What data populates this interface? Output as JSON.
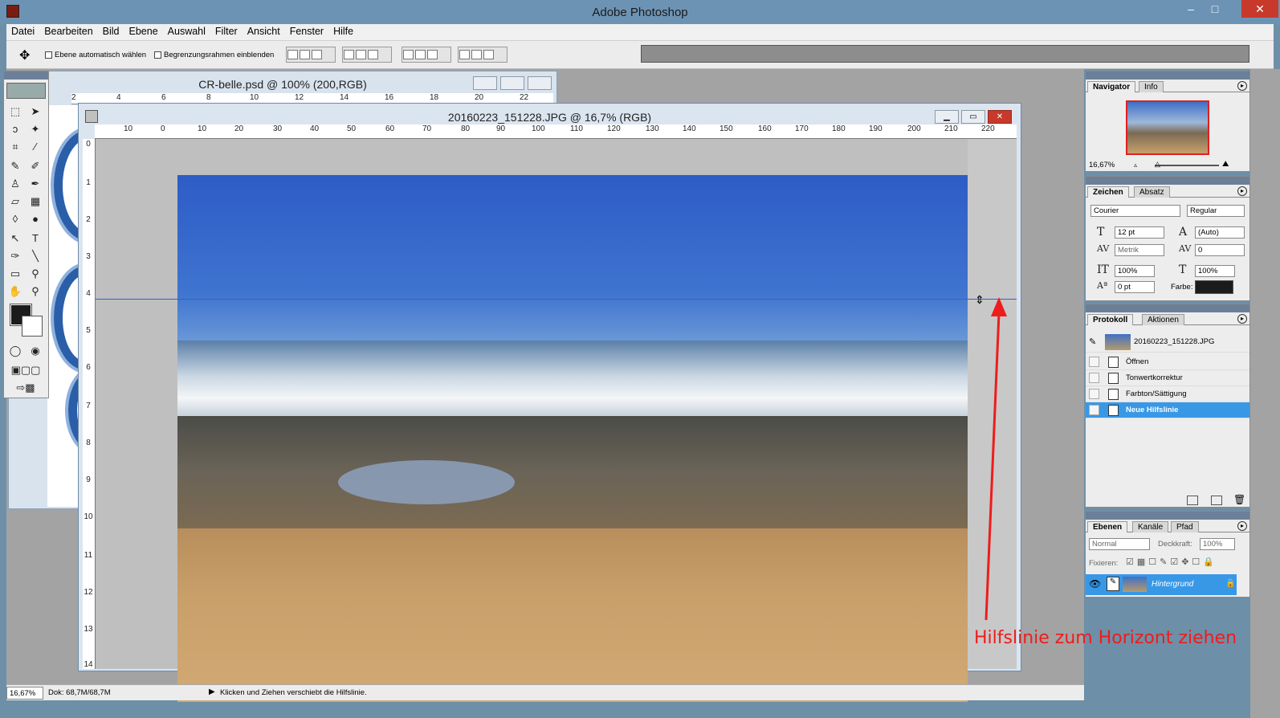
{
  "app": {
    "title": "Adobe Photoshop",
    "window_controls": {
      "minimize": "–",
      "maximize": "□",
      "close": "✕"
    }
  },
  "menu": {
    "items": [
      "Datei",
      "Bearbeiten",
      "Bild",
      "Ebene",
      "Auswahl",
      "Filter",
      "Ansicht",
      "Fenster",
      "Hilfe"
    ]
  },
  "options": {
    "auto_select": "Ebene automatisch wählen",
    "bounding_box": "Begrenzungsrahmen einblenden"
  },
  "doc1": {
    "title": "CR-belle.psd @ 100% (200,RGB)",
    "ruler": [
      "2",
      "4",
      "6",
      "8",
      "10",
      "12",
      "14",
      "16",
      "18",
      "20",
      "22"
    ]
  },
  "doc2": {
    "title": "20160223_151228.JPG @ 16,7% (RGB)",
    "ruler": [
      "10",
      "0",
      "10",
      "20",
      "30",
      "40",
      "50",
      "60",
      "70",
      "80",
      "90",
      "100",
      "110",
      "120",
      "130",
      "140",
      "150",
      "160",
      "170",
      "180",
      "190",
      "200",
      "210",
      "220"
    ],
    "vruler": [
      "0",
      "1",
      "2",
      "3",
      "4",
      "5",
      "6",
      "7",
      "8",
      "9",
      "10",
      "11",
      "12",
      "13",
      "14"
    ]
  },
  "annotation": "Hilfslinie zum Horizont ziehen",
  "status": {
    "zoom": "16,67%",
    "dok": "Dok: 68,7M/68,7M",
    "message": "Klicken und Ziehen verschiebt die Hilfslinie."
  },
  "navigator": {
    "tabs": [
      "Navigator",
      "Info"
    ],
    "zoom": "16,67%"
  },
  "character": {
    "tabs": [
      "Zeichen",
      "Absatz"
    ],
    "font": "Courier",
    "style": "Regular",
    "size": "12 pt",
    "leading": "(Auto)",
    "kerning": "Metrik",
    "tracking": "0",
    "vscale": "100%",
    "hscale": "100%",
    "baseline": "0 pt",
    "color_label": "Farbe:"
  },
  "history": {
    "tabs": [
      "Protokoll",
      "Aktionen"
    ],
    "snapshot": "20160223_151228.JPG",
    "steps": [
      "Öffnen",
      "Tonwertkorrektur",
      "Farbton/Sättigung",
      "Neue Hilfslinie"
    ]
  },
  "layers": {
    "tabs": [
      "Ebenen",
      "Kanäle",
      "Pfad"
    ],
    "blend": "Normal",
    "opacity_label": "Deckkraft:",
    "opacity": "100%",
    "lock_label": "Fixieren:",
    "layer_name": "Hintergrund"
  }
}
